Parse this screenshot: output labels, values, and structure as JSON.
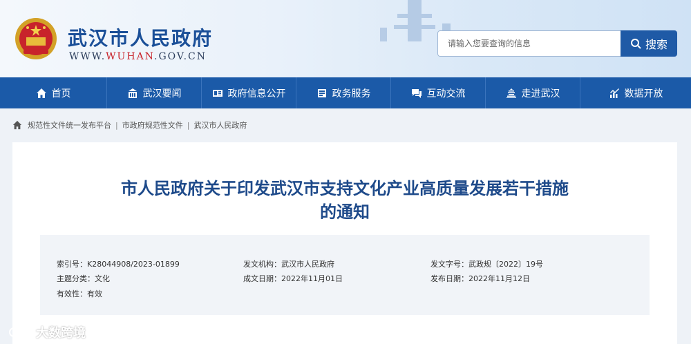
{
  "header": {
    "site_title": "武汉市人民政府",
    "url_prefix": "WWW.",
    "url_accent": "WUHAN",
    "url_suffix": ".GOV.CN",
    "search_placeholder": "请输入您要查询的信息",
    "search_button": "搜索"
  },
  "nav": {
    "items": [
      {
        "label": "首页",
        "icon": "home-icon"
      },
      {
        "label": "武汉要闻",
        "icon": "news-icon"
      },
      {
        "label": "政府信息公开",
        "icon": "info-icon"
      },
      {
        "label": "政务服务",
        "icon": "service-icon"
      },
      {
        "label": "互动交流",
        "icon": "chat-icon"
      },
      {
        "label": "走进武汉",
        "icon": "building-icon"
      },
      {
        "label": "数据开放",
        "icon": "chart-icon"
      }
    ]
  },
  "breadcrumb": {
    "items": [
      "规范性文件统一发布平台",
      "市政府规范性文件",
      "武汉市人民政府"
    ],
    "separator": "|"
  },
  "article": {
    "title_line1": "市人民政府关于印发武汉市支持文化产业高质量发展若干措施",
    "title_line2": "的通知"
  },
  "meta": {
    "index_label": "索引号：",
    "index_value": "K28044908/2023-01899",
    "issuer_label": "发文机构：",
    "issuer_value": "武汉市人民政府",
    "docno_label": "发文字号：",
    "docno_value": "武政规〔2022〕19号",
    "category_label": "主题分类：",
    "category_value": "文化",
    "created_label": "成文日期：",
    "created_value": "2022年11月01日",
    "published_label": "发布日期：",
    "published_value": "2022年11月12日",
    "validity_label": "有效性：",
    "validity_value": "有效"
  },
  "watermark": {
    "text": "大数跨境"
  },
  "colors": {
    "brand_blue": "#1b5aa8",
    "title_blue": "#1e4a8a",
    "accent_red": "#c8232b"
  }
}
